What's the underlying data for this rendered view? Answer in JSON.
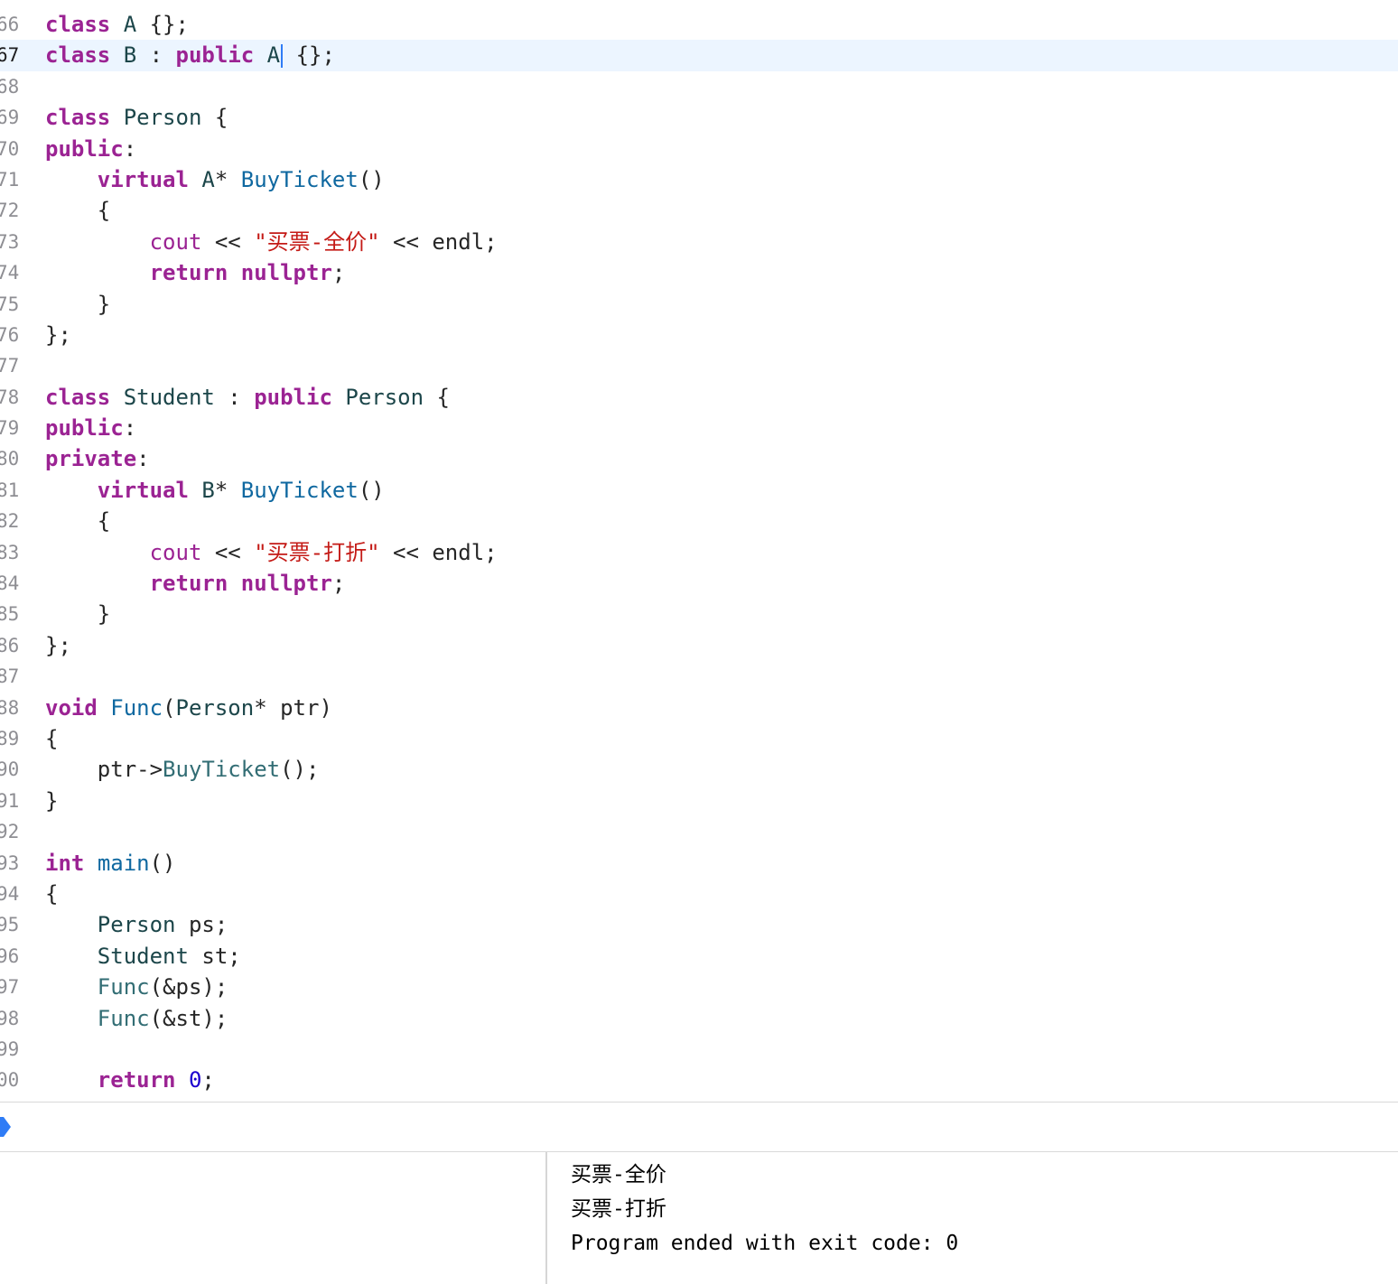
{
  "editor": {
    "current_line": "67",
    "lines": [
      {
        "num": "66",
        "tokens": [
          [
            "kw",
            "class"
          ],
          [
            "plain",
            " "
          ],
          [
            "ty",
            "A"
          ],
          [
            "plain",
            " {};"
          ]
        ]
      },
      {
        "num": "67",
        "tokens": [
          [
            "kw",
            "class"
          ],
          [
            "plain",
            " "
          ],
          [
            "ty",
            "B"
          ],
          [
            "plain",
            " : "
          ],
          [
            "kw",
            "public"
          ],
          [
            "plain",
            " "
          ],
          [
            "ty",
            "A"
          ],
          [
            "caret",
            ""
          ],
          [
            "plain",
            " {};"
          ]
        ]
      },
      {
        "num": "68",
        "tokens": []
      },
      {
        "num": "69",
        "tokens": [
          [
            "kw",
            "class"
          ],
          [
            "plain",
            " "
          ],
          [
            "ty",
            "Person"
          ],
          [
            "plain",
            " {"
          ]
        ]
      },
      {
        "num": "70",
        "tokens": [
          [
            "kw",
            "public"
          ],
          [
            "plain",
            ":"
          ]
        ]
      },
      {
        "num": "71",
        "tokens": [
          [
            "plain",
            "    "
          ],
          [
            "kw",
            "virtual"
          ],
          [
            "plain",
            " "
          ],
          [
            "ty",
            "A"
          ],
          [
            "plain",
            "* "
          ],
          [
            "fdecl",
            "BuyTicket"
          ],
          [
            "plain",
            "()"
          ]
        ]
      },
      {
        "num": "72",
        "tokens": [
          [
            "plain",
            "    {"
          ]
        ]
      },
      {
        "num": "73",
        "tokens": [
          [
            "plain",
            "        "
          ],
          [
            "kw2",
            "cout"
          ],
          [
            "plain",
            " << "
          ],
          [
            "str",
            "\"买票-全价\""
          ],
          [
            "plain",
            " << endl;"
          ]
        ]
      },
      {
        "num": "74",
        "tokens": [
          [
            "plain",
            "        "
          ],
          [
            "kw",
            "return"
          ],
          [
            "plain",
            " "
          ],
          [
            "kw",
            "nullptr"
          ],
          [
            "plain",
            ";"
          ]
        ]
      },
      {
        "num": "75",
        "tokens": [
          [
            "plain",
            "    }"
          ]
        ]
      },
      {
        "num": "76",
        "tokens": [
          [
            "plain",
            "};"
          ]
        ]
      },
      {
        "num": "77",
        "tokens": []
      },
      {
        "num": "78",
        "tokens": [
          [
            "kw",
            "class"
          ],
          [
            "plain",
            " "
          ],
          [
            "ty",
            "Student"
          ],
          [
            "plain",
            " : "
          ],
          [
            "kw",
            "public"
          ],
          [
            "plain",
            " "
          ],
          [
            "ty",
            "Person"
          ],
          [
            "plain",
            " {"
          ]
        ]
      },
      {
        "num": "79",
        "tokens": [
          [
            "kw",
            "public"
          ],
          [
            "plain",
            ":"
          ]
        ]
      },
      {
        "num": "80",
        "tokens": [
          [
            "kw",
            "private"
          ],
          [
            "plain",
            ":"
          ]
        ]
      },
      {
        "num": "81",
        "tokens": [
          [
            "plain",
            "    "
          ],
          [
            "kw",
            "virtual"
          ],
          [
            "plain",
            " "
          ],
          [
            "ty",
            "B"
          ],
          [
            "plain",
            "* "
          ],
          [
            "fdecl",
            "BuyTicket"
          ],
          [
            "plain",
            "()"
          ]
        ]
      },
      {
        "num": "82",
        "tokens": [
          [
            "plain",
            "    {"
          ]
        ]
      },
      {
        "num": "83",
        "tokens": [
          [
            "plain",
            "        "
          ],
          [
            "kw2",
            "cout"
          ],
          [
            "plain",
            " << "
          ],
          [
            "str",
            "\"买票-打折\""
          ],
          [
            "plain",
            " << endl;"
          ]
        ]
      },
      {
        "num": "84",
        "tokens": [
          [
            "plain",
            "        "
          ],
          [
            "kw",
            "return"
          ],
          [
            "plain",
            " "
          ],
          [
            "kw",
            "nullptr"
          ],
          [
            "plain",
            ";"
          ]
        ]
      },
      {
        "num": "85",
        "tokens": [
          [
            "plain",
            "    }"
          ]
        ]
      },
      {
        "num": "86",
        "tokens": [
          [
            "plain",
            "};"
          ]
        ]
      },
      {
        "num": "87",
        "tokens": []
      },
      {
        "num": "88",
        "tokens": [
          [
            "kw",
            "void"
          ],
          [
            "plain",
            " "
          ],
          [
            "fdecl",
            "Func"
          ],
          [
            "plain",
            "("
          ],
          [
            "ty",
            "Person"
          ],
          [
            "plain",
            "* ptr)"
          ]
        ]
      },
      {
        "num": "89",
        "tokens": [
          [
            "plain",
            "{"
          ]
        ]
      },
      {
        "num": "90",
        "tokens": [
          [
            "plain",
            "    ptr->"
          ],
          [
            "fn",
            "BuyTicket"
          ],
          [
            "plain",
            "();"
          ]
        ]
      },
      {
        "num": "91",
        "tokens": [
          [
            "plain",
            "}"
          ]
        ]
      },
      {
        "num": "92",
        "tokens": []
      },
      {
        "num": "93",
        "tokens": [
          [
            "kw",
            "int"
          ],
          [
            "plain",
            " "
          ],
          [
            "fdecl",
            "main"
          ],
          [
            "plain",
            "()"
          ]
        ]
      },
      {
        "num": "94",
        "tokens": [
          [
            "plain",
            "{"
          ]
        ]
      },
      {
        "num": "95",
        "tokens": [
          [
            "plain",
            "    "
          ],
          [
            "ty",
            "Person"
          ],
          [
            "plain",
            " ps;"
          ]
        ]
      },
      {
        "num": "96",
        "tokens": [
          [
            "plain",
            "    "
          ],
          [
            "ty",
            "Student"
          ],
          [
            "plain",
            " st;"
          ]
        ]
      },
      {
        "num": "97",
        "tokens": [
          [
            "plain",
            "    "
          ],
          [
            "fn",
            "Func"
          ],
          [
            "plain",
            "(&ps);"
          ]
        ]
      },
      {
        "num": "98",
        "tokens": [
          [
            "plain",
            "    "
          ],
          [
            "fn",
            "Func"
          ],
          [
            "plain",
            "(&st);"
          ]
        ]
      },
      {
        "num": "99",
        "tokens": []
      },
      {
        "num": "00",
        "tokens": [
          [
            "plain",
            "    "
          ],
          [
            "kw",
            "return"
          ],
          [
            "plain",
            " "
          ],
          [
            "num",
            "0"
          ],
          [
            "plain",
            ";"
          ]
        ]
      }
    ]
  },
  "console": {
    "output": [
      "买票-全价",
      "买票-打折",
      "Program ended with exit code: 0"
    ]
  },
  "colors": {
    "keyword": "#9b2393",
    "string": "#c41a16",
    "type": "#1c464a",
    "function_decl": "#0f68a0",
    "current_line_bg": "#ecf5ff",
    "debug_arrow": "#2f7cf6"
  }
}
